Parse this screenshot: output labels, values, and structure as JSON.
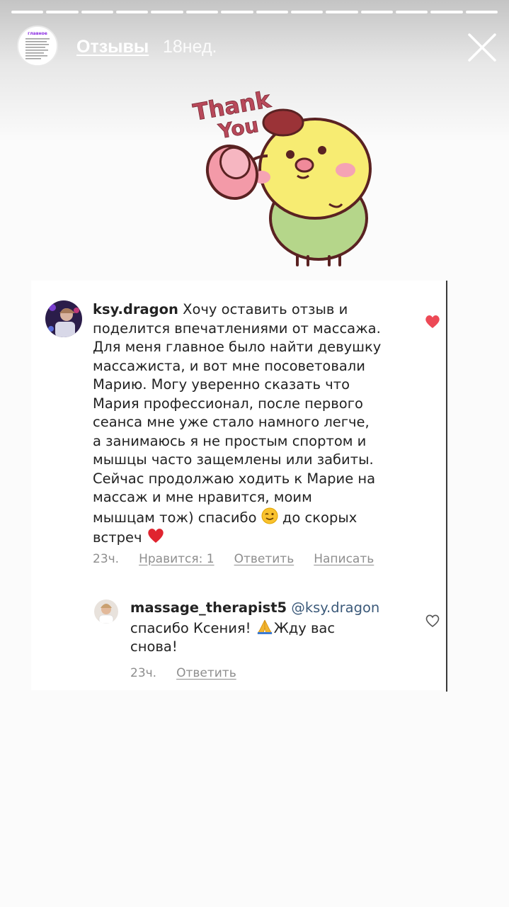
{
  "story": {
    "segments": 14,
    "title": "Отзывы",
    "time": "18нед."
  },
  "sticker": {
    "line1": "Thank",
    "line2": "You"
  },
  "comment": {
    "username": "ksy.dragon",
    "lines": [
      "Хочу оставить отзыв и",
      "поделится впечатлениями от массажа.",
      "Для меня главное было найти девушку",
      "массажиста, и вот мне посоветовали",
      "Марию. Могу уверенно сказать что",
      "Мария профессионал, после первого",
      "сеанса мне уже стало намного легче,",
      "а занимаюсь я не простым спортом и",
      "мышцы часто защемлены или забиты.",
      "Сейчас продолжаю ходить к Марие на",
      "массаж и мне нравится,  моим",
      "мышцам тож) спасибо",
      "до скорых",
      "встреч"
    ],
    "time": "23ч.",
    "likes": "Нравится: 1",
    "reply": "Ответить",
    "message": "Написать",
    "liked": true
  },
  "reply_comment": {
    "username": "massage_therapist5",
    "mention": "@ksy.dragon",
    "line1": "спасибо Ксения!",
    "line1b": "Жду вас",
    "line2": "снова!",
    "time": "23ч.",
    "reply": "Ответить",
    "liked": false
  },
  "colors": {
    "heart_red": "#ed4956",
    "mention_blue": "#3c5a7a",
    "meta_gray": "#8e8e8e"
  }
}
